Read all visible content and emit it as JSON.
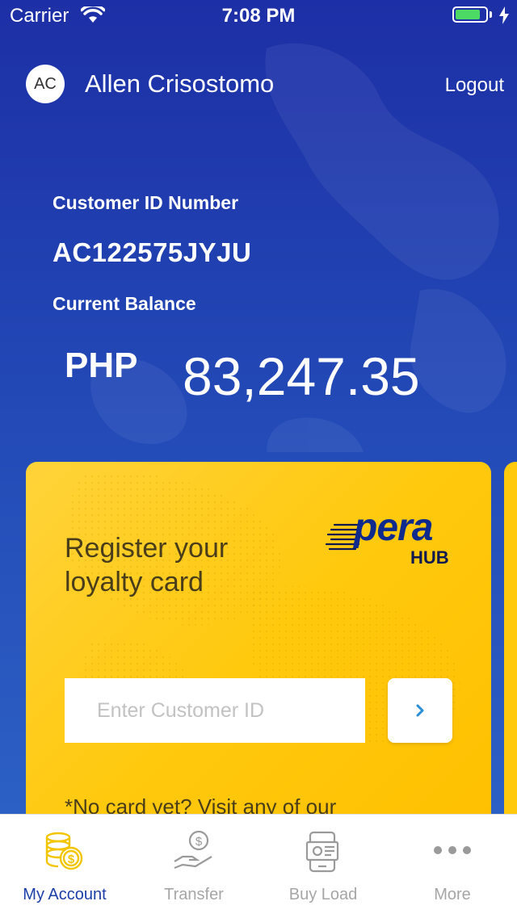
{
  "status_bar": {
    "carrier": "Carrier",
    "time": "7:08 PM",
    "battery_level": 0.85
  },
  "header": {
    "avatar_initials": "AC",
    "user_name": "Allen Crisostomo",
    "logout_label": "Logout"
  },
  "account": {
    "customer_id_label": "Customer ID Number",
    "customer_id": "AC122575JYJU",
    "balance_label": "Current Balance",
    "currency": "PHP",
    "balance": "83,247.35"
  },
  "loyalty_card": {
    "title": "Register your loyalty card",
    "logo_text": "pera",
    "logo_subtext": "HUB",
    "input_placeholder": "Enter Customer ID",
    "note": "*No card yet? Visit any of our",
    "card_color": "#ffc90e"
  },
  "tabbar": {
    "tabs": [
      {
        "label": "My Account",
        "icon": "coins-icon",
        "active": true
      },
      {
        "label": "Transfer",
        "icon": "hand-money-icon",
        "active": false
      },
      {
        "label": "Buy Load",
        "icon": "phone-load-icon",
        "active": false
      },
      {
        "label": "More",
        "icon": "more-dots-icon",
        "active": false
      }
    ],
    "active_color": "#1d3fa8",
    "inactive_color": "#a6a6a6"
  }
}
